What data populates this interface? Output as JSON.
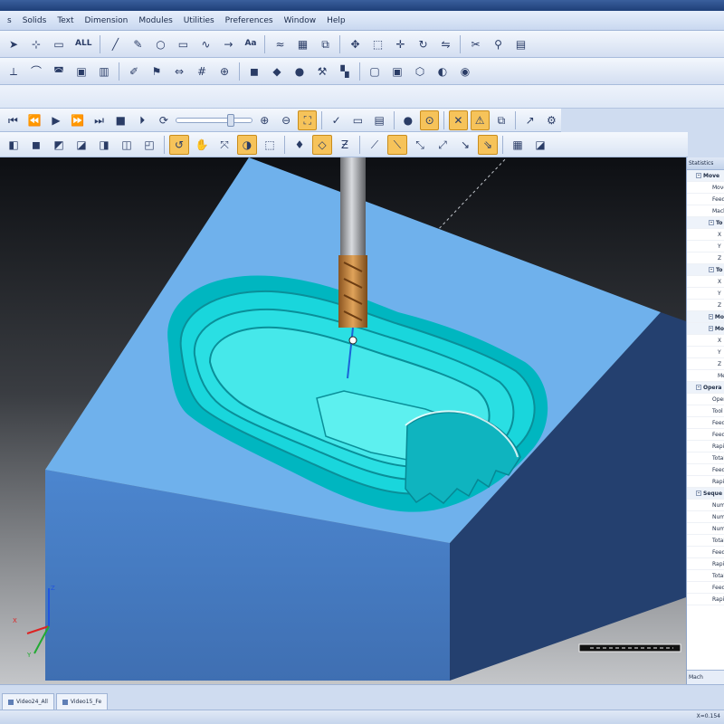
{
  "menu": [
    "s",
    "Solids",
    "Text",
    "Dimension",
    "Modules",
    "Utilities",
    "Preferences",
    "Window",
    "Help"
  ],
  "toolbar1": {
    "all_label": "ALL",
    "text_label": "Aa"
  },
  "toolbar_icons": {
    "select": "pointer-icon",
    "point": "point-icon",
    "line": "line-icon",
    "circle": "circle-icon",
    "rectangle": "rectangle-icon",
    "spline": "spline-icon",
    "transform": "transform-icon",
    "shade": "shade-icon",
    "zoom": "zoom-icon",
    "rotate": "rotate-icon"
  },
  "playback": {
    "slider_value": 0.68
  },
  "stats_panel": {
    "title": "Statistics",
    "rows": [
      {
        "type": "grp",
        "label": "Move"
      },
      {
        "type": "sub",
        "label": "Move Ra"
      },
      {
        "type": "sub",
        "label": "Feed Ra"
      },
      {
        "type": "sub",
        "label": "Machin"
      },
      {
        "type": "grp2",
        "label": "To"
      },
      {
        "type": "sub2",
        "label": "X"
      },
      {
        "type": "sub2",
        "label": "Y"
      },
      {
        "type": "sub2",
        "label": "Z"
      },
      {
        "type": "grp2",
        "label": "To"
      },
      {
        "type": "sub2",
        "label": "X"
      },
      {
        "type": "sub2",
        "label": "Y"
      },
      {
        "type": "sub2",
        "label": "Z"
      },
      {
        "type": "grp2",
        "label": "Mo"
      },
      {
        "type": "grp2",
        "label": "Mo"
      },
      {
        "type": "sub2",
        "label": "X"
      },
      {
        "type": "sub2",
        "label": "Y"
      },
      {
        "type": "sub2",
        "label": "Z"
      },
      {
        "type": "sub2",
        "label": "Me"
      },
      {
        "type": "grp",
        "label": "Opera"
      },
      {
        "type": "sub",
        "label": "Operat"
      },
      {
        "type": "sub",
        "label": "Tool"
      },
      {
        "type": "sub",
        "label": "Feed Pl"
      },
      {
        "type": "sub",
        "label": "Feed Pl"
      },
      {
        "type": "sub",
        "label": "Rapid"
      },
      {
        "type": "sub",
        "label": "Total M"
      },
      {
        "type": "sub",
        "label": "Feed M"
      },
      {
        "type": "sub",
        "label": "Rapid"
      },
      {
        "type": "grp",
        "label": "Seque"
      },
      {
        "type": "sub",
        "label": "Numbe"
      },
      {
        "type": "sub",
        "label": "Numbe"
      },
      {
        "type": "sub",
        "label": "Numbe"
      },
      {
        "type": "sub",
        "label": "Total M"
      },
      {
        "type": "sub",
        "label": "Feed Pl"
      },
      {
        "type": "sub",
        "label": "Rapid"
      },
      {
        "type": "sub",
        "label": "Total M"
      },
      {
        "type": "sub",
        "label": "Feed M"
      },
      {
        "type": "sub",
        "label": "Rapid"
      }
    ],
    "tab_label": "Mach"
  },
  "doc_tabs": [
    "Video24_All",
    "Video15_Fe"
  ],
  "status": {
    "coords": "X=0.154"
  },
  "colors": {
    "stock_top": "#6fb1ec",
    "stock_front": "#4b82c9",
    "stock_right": "#26406e",
    "cut_surface": "#00d8dc",
    "tool_shank": "#a9abaf",
    "tool_flute": "#c9853a",
    "toolbar_highlight": "#f6c35a"
  }
}
